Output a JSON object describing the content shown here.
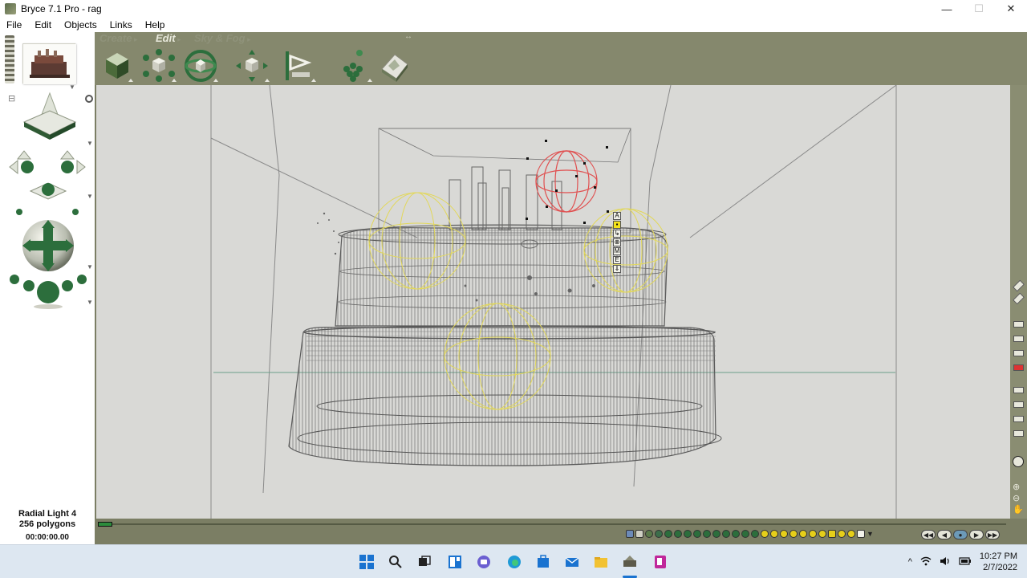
{
  "window": {
    "title": "Bryce 7.1  Pro - rag",
    "minimize": "—",
    "maximize": "☐",
    "close": "✕"
  },
  "menubar": {
    "items": [
      "File",
      "Edit",
      "Objects",
      "Links",
      "Help"
    ]
  },
  "palette_tabs": {
    "create": "Create",
    "edit": "Edit",
    "sky_fog": "Sky & Fog",
    "active": "edit"
  },
  "edit_tools": [
    {
      "name": "material-lab",
      "icon": "cube-icon"
    },
    {
      "name": "resize",
      "icon": "resize-icon"
    },
    {
      "name": "rotate",
      "icon": "rotate-icon"
    },
    {
      "name": "reposition",
      "icon": "reposition-icon"
    },
    {
      "name": "align",
      "icon": "align-icon"
    },
    {
      "name": "randomize",
      "icon": "randomize-icon"
    },
    {
      "name": "terrain-editor",
      "icon": "terrain-icon"
    }
  ],
  "viewport": {
    "background": "#d9d9d6",
    "wireframe_color": "#6e6e6e",
    "selected_color": "#e05050",
    "light_color": "#e2d85a",
    "context_letters": [
      "A",
      "▪",
      "↳",
      "⊗",
      "M",
      "E",
      "⇓"
    ]
  },
  "status": {
    "object_name": "Radial Light 4",
    "polygons": "256 polygons",
    "timecode": "00:00:00.00"
  },
  "taskbar": {
    "time": "10:27 PM",
    "date": "2/7/2022",
    "tray_up": "^"
  },
  "colors": {
    "bryce_frame": "#7b7e64",
    "palette_bg": "#85886d",
    "accent_green": "#2c6e3c",
    "taskbar_bg": "#dde7f1"
  }
}
